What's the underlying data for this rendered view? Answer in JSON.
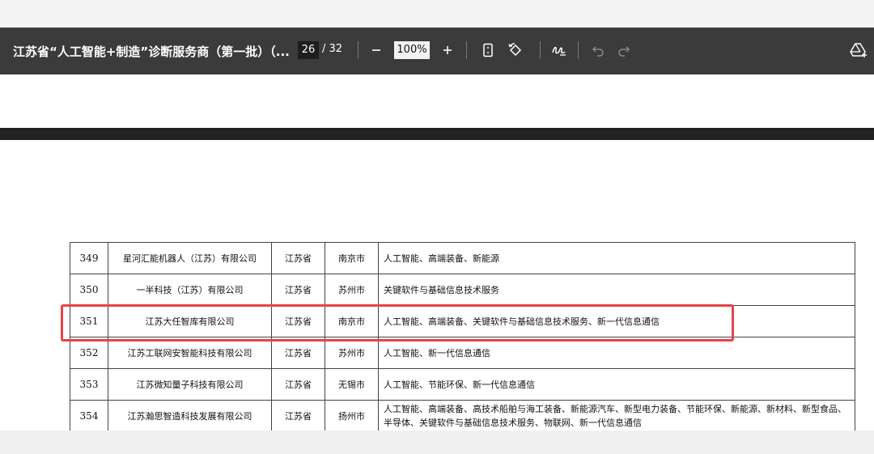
{
  "toolbar": {
    "doc_title": "江苏省“人工智能+制造”诊断服务商（第一批）（...",
    "page_current": "26",
    "page_total": "/ 32",
    "zoom": "100%",
    "icons": [
      "zoom-out-icon",
      "zoom-in-icon",
      "fit-page-icon",
      "rotate-icon",
      "draw-icon",
      "undo-icon",
      "redo-icon",
      "save-to-drive-icon"
    ]
  },
  "table": {
    "rows": [
      {
        "num": "349",
        "name": "星河汇能机器人（江苏）有限公司",
        "province": "江苏省",
        "city": "南京市",
        "fields": "人工智能、高端装备、新能源"
      },
      {
        "num": "350",
        "name": "一半科技（江苏）有限公司",
        "province": "江苏省",
        "city": "苏州市",
        "fields": "关键软件与基础信息技术服务"
      },
      {
        "num": "351",
        "name": "江苏大任智库有限公司",
        "province": "江苏省",
        "city": "南京市",
        "fields": "人工智能、高端装备、关键软件与基础信息技术服务、新一代信息通信"
      },
      {
        "num": "352",
        "name": "江苏工联网安智能科技有限公司",
        "province": "江苏省",
        "city": "苏州市",
        "fields": "人工智能、新一代信息通信"
      },
      {
        "num": "353",
        "name": "江苏微知量子科技有限公司",
        "province": "江苏省",
        "city": "无锡市",
        "fields": "人工智能、节能环保、新一代信息通信"
      },
      {
        "num": "354",
        "name": "江苏瀚思智造科技发展有限公司",
        "province": "江苏省",
        "city": "扬州市",
        "fields": "人工智能、高端装备、高技术船舶与海工装备、新能源汽车、新型电力装备、节能环保、新能源、新材料、新型食品、半导体、关键软件与基础信息技术服务、物联网、新一代信息通信"
      }
    ]
  },
  "highlight_color": "#e8424a"
}
